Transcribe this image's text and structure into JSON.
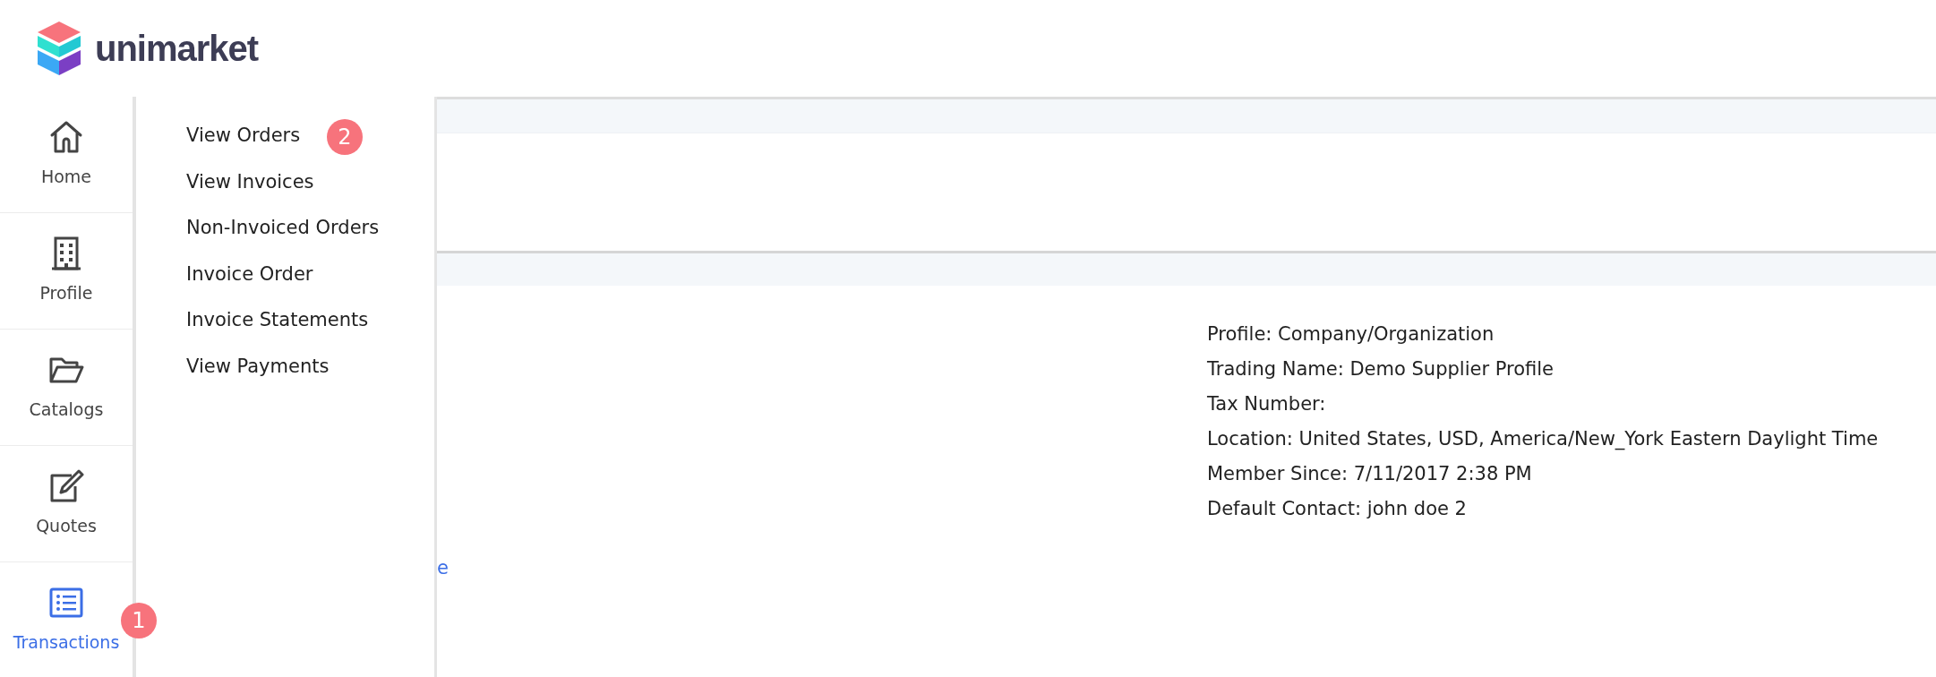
{
  "logo": {
    "text": "unimarket"
  },
  "sidebar": {
    "items": [
      {
        "label": "Home",
        "kind": "home",
        "selected": false
      },
      {
        "label": "Profile",
        "kind": "building",
        "selected": false
      },
      {
        "label": "Catalogs",
        "kind": "folder",
        "selected": false
      },
      {
        "label": "Quotes",
        "kind": "edit",
        "selected": false
      },
      {
        "label": "Transactions",
        "kind": "list",
        "selected": true
      }
    ],
    "badge": "1"
  },
  "flyout": {
    "items": [
      {
        "label": "View Orders"
      },
      {
        "label": "View Invoices"
      },
      {
        "label": "Non-Invoiced Orders"
      },
      {
        "label": "Invoice Order"
      },
      {
        "label": "Invoice Statements"
      },
      {
        "label": "View Payments"
      }
    ],
    "badge": "2"
  },
  "content": {
    "link_fragment": "e",
    "details": [
      "Profile: Company/Organization",
      "Trading Name: Demo Supplier Profile",
      "Tax Number:",
      "Location: United States, USD, America/New_York Eastern Daylight Time",
      "Member Since: 7/11/2017 2:38 PM",
      "Default Contact: john doe 2"
    ]
  }
}
